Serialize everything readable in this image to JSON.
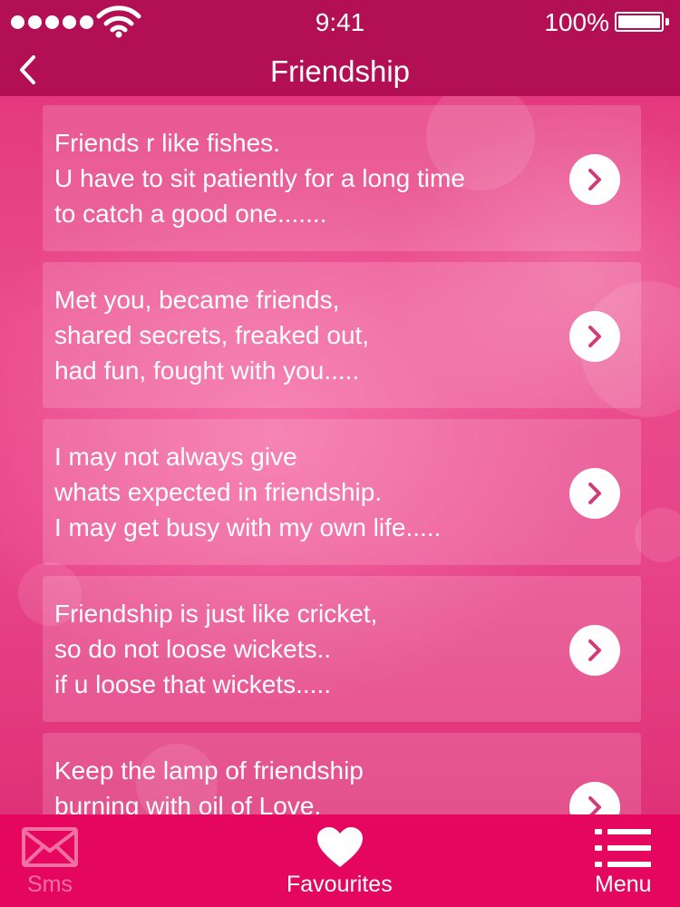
{
  "status_bar": {
    "time": "9:41",
    "battery": "100%",
    "icons": [
      "signal-dots-icon",
      "wifi-icon",
      "battery-icon"
    ]
  },
  "nav": {
    "title": "Friendship",
    "back_icon": "chevron-left-icon"
  },
  "items": [
    {
      "lines": [
        "Friends r like fishes.",
        "U have to sit patiently for a long time",
        "to catch a good one......."
      ]
    },
    {
      "lines": [
        "Met you, became friends,",
        "shared secrets, freaked out,",
        "had fun, fought with you....."
      ]
    },
    {
      "lines": [
        "I may not always give",
        "whats expected in friendship.",
        "I may get busy with my own life....."
      ]
    },
    {
      "lines": [
        "Friendship is just like cricket,",
        "so do not loose wickets..",
        "if u loose that wickets....."
      ]
    },
    {
      "lines": [
        "Keep the lamp of friendship",
        "burning with oil of Love,"
      ]
    }
  ],
  "tabs": [
    {
      "label": "Sms",
      "icon": "envelope-icon",
      "state": "inactive"
    },
    {
      "label": "Favourites",
      "icon": "heart-icon",
      "state": "active"
    },
    {
      "label": "Menu",
      "icon": "list-menu-icon",
      "state": "active"
    }
  ],
  "colors": {
    "bar": "#b20f55",
    "tab_bar": "#e4065f",
    "accent": "#d43a78",
    "tab_inactive": "#f26fa3"
  }
}
